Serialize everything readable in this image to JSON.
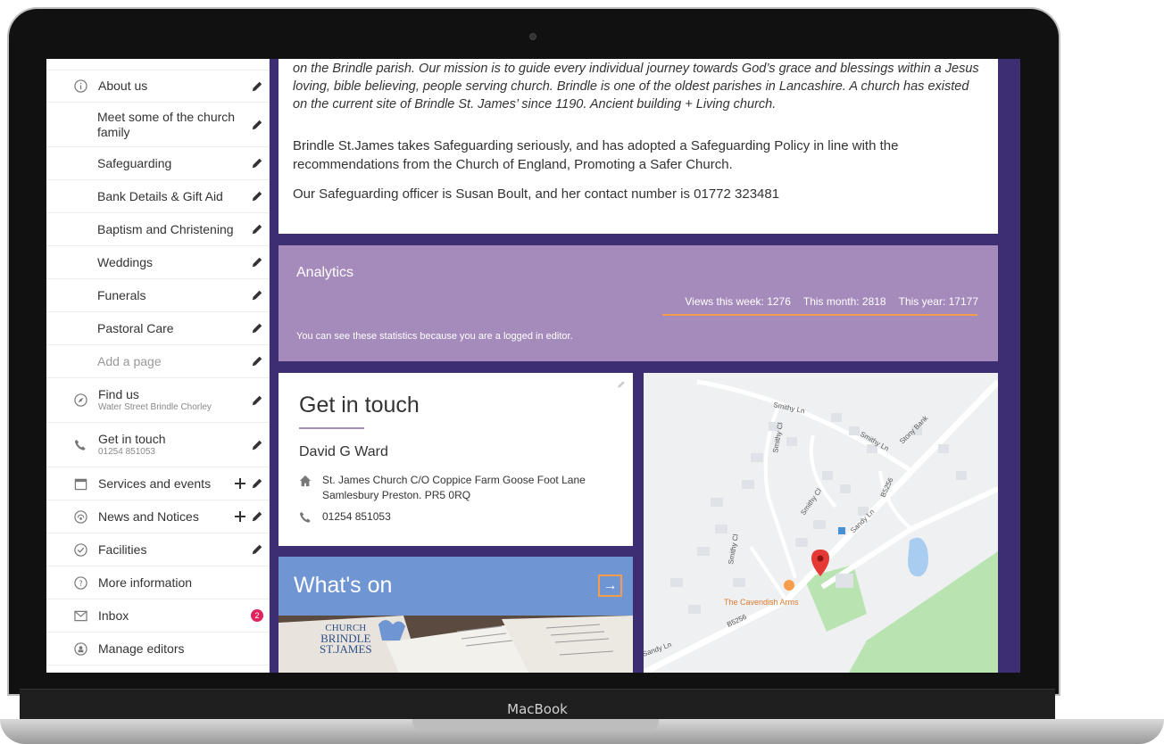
{
  "device": {
    "brand_label": "MacBook"
  },
  "sidebar": {
    "items": [
      {
        "label": "About us",
        "icon": "info-icon",
        "sub": false
      },
      {
        "label": "Meet some of the church family",
        "sub": true
      },
      {
        "label": "Safeguarding",
        "sub": true
      },
      {
        "label": "Bank Details & Gift Aid",
        "sub": true
      },
      {
        "label": "Baptism and Christening",
        "sub": true
      },
      {
        "label": "Weddings",
        "sub": true
      },
      {
        "label": "Funerals",
        "sub": true
      },
      {
        "label": "Pastoral Care",
        "sub": true
      },
      {
        "label": "Add a page",
        "sub": true
      }
    ],
    "find_us": {
      "label": "Find us",
      "subtext": "Water Street Brindle Chorley"
    },
    "get_in_touch": {
      "label": "Get in touch",
      "subtext": "01254 851053"
    },
    "services": {
      "label": "Services and events"
    },
    "news": {
      "label": "News and Notices"
    },
    "facilities": {
      "label": "Facilities"
    },
    "more_info": {
      "label": "More information"
    },
    "inbox": {
      "label": "Inbox",
      "badge": "2"
    },
    "manage_editors": {
      "label": "Manage editors"
    }
  },
  "about": {
    "italic_text": "on the Brindle parish. Our mission is to guide every individual journey towards God’s grace and blessings within a Jesus loving, bible believing, people serving church. Brindle is one of the oldest parishes in Lancashire. A church has existed on the current site of Brindle St. James’ since 1190. Ancient building + Living church.",
    "safeguarding_text": "Brindle St.James takes Safeguarding seriously, and has adopted a Safeguarding Policy in line with the recommendations from the Church of England, Promoting a Safer Church.",
    "officer_text": "Our Safeguarding officer is Susan Boult, and her contact number is 01772 323481"
  },
  "analytics": {
    "title": "Analytics",
    "views_week": "Views this week: 1276",
    "views_month": "This month: 2818",
    "views_year": "This year: 17177",
    "note": "You can see these statistics because you are a logged in editor."
  },
  "contact": {
    "title": "Get in touch",
    "name": "David G Ward",
    "address": "St. James Church C/O Coppice Farm Goose Foot Lane Samlesbury Preston. PR5 0RQ",
    "phone": "01254 851053"
  },
  "whats_on": {
    "title": "What's on",
    "arrow": "→",
    "logo_line1": "CHURCH",
    "logo_line2": "BRINDLE",
    "logo_line3": "ST.JAMES"
  },
  "map": {
    "labels": [
      "Smithy Ln",
      "Smithy Cl",
      "Smithy Ln",
      "Stony Bank",
      "B5256",
      "Sandy Ln",
      "Smithy Cl",
      "Smithy Cl",
      "The Cavendish Arms",
      "B5256",
      "Sandy Ln"
    ]
  },
  "colors": {
    "accent": "#a58bbb",
    "frame": "#3d2e74",
    "whats_on": "#6f95d3",
    "line": "#f59d4c",
    "badge": "#e0245e"
  }
}
